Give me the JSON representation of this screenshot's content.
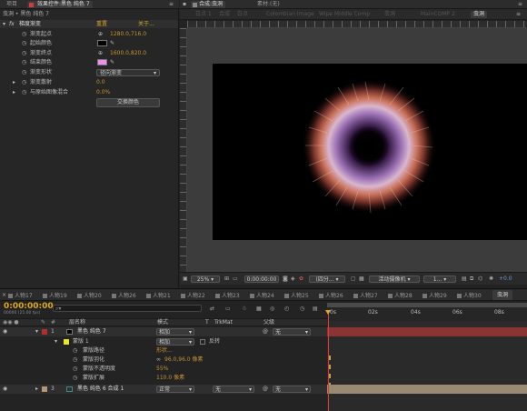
{
  "left_panel": {
    "tabs": [
      "项目",
      "效果控件:黑色 纯色 7"
    ],
    "breadcrumb": "虫洞 • 黑色 纯色 7",
    "effect": {
      "name": "梯度渐变",
      "reset_label": "重置",
      "about_label": "关于...",
      "props": [
        {
          "label": "渐变起点",
          "value": "1280.0,716.0"
        },
        {
          "label": "起始颜色",
          "value": "",
          "swatch": "#000000"
        },
        {
          "label": "渐变终点",
          "value": "1600.0,820.0"
        },
        {
          "label": "结束颜色",
          "value": "",
          "swatch": "#f08ef0"
        },
        {
          "label": "渐变形状",
          "value": "径向渐变"
        },
        {
          "label": "渐变散射",
          "value": "0.0"
        },
        {
          "label": "与原始图像混合",
          "value": "0.0%"
        }
      ],
      "swap_button": "交换颜色"
    }
  },
  "viewer": {
    "tabs": [
      "合成:虫洞",
      "素材:(无)"
    ],
    "breadcrumbs": [
      "白点 1",
      "合成",
      "白点",
      "Colombian Image",
      "Wipe Middle Comp",
      "虫洞",
      "MainCOMP 2",
      "虫洞"
    ],
    "active_breadcrumb": "虫洞",
    "toolbar": {
      "zoom": "25%",
      "timecode": "0:00:00:00",
      "resolution": "(四分...",
      "camera": "活动摄像机",
      "views": "1...",
      "offset": "+0.0"
    }
  },
  "timeline": {
    "comp_tabs": [
      "人物17",
      "人物19",
      "人物20",
      "人物26",
      "人物21",
      "人物22",
      "人物23",
      "人物24",
      "人物25",
      "人物26",
      "人物27",
      "人物28",
      "人物29",
      "人物30",
      "虫洞"
    ],
    "active_comp_tab": "虫洞",
    "timecode": "0:00:00:00",
    "timecode_sub": "00000 (25.00 fps)",
    "search_placeholder": "",
    "headers": {
      "layer_name": "层名称",
      "mode": "模式",
      "t": "T",
      "trkmat": "TrkMat",
      "parent": "父级"
    },
    "time_marks": [
      "0s",
      "02s",
      "04s",
      "06s",
      "08s"
    ],
    "layers": [
      {
        "num": "1",
        "name": "黑色 纯色 7",
        "mode": "相加",
        "trkmat": "",
        "parent": "无",
        "color": "#b03030"
      },
      {
        "num": "3",
        "name": "黑色 纯色 6 合成 1",
        "mode": "正常",
        "trkmat": "无",
        "parent": "无",
        "color": "#3a8a8a"
      }
    ],
    "mask": {
      "name": "蒙版 1",
      "mode": "相加",
      "inverted_label": "反转",
      "props": [
        {
          "label": "蒙版路径",
          "value": "形状..."
        },
        {
          "label": "蒙版羽化",
          "value": "96.0,96.0 像素"
        },
        {
          "label": "蒙版不透明度",
          "value": "55%"
        },
        {
          "label": "蒙版扩展",
          "value": "110.0 像素"
        }
      ]
    }
  }
}
